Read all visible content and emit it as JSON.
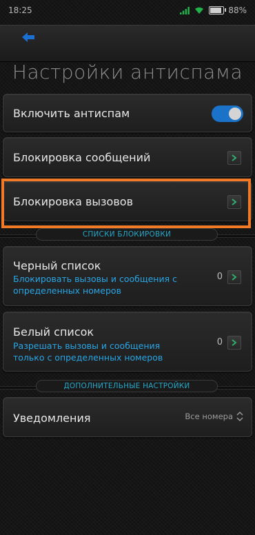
{
  "status_bar": {
    "time": "18:25",
    "battery": "88%"
  },
  "screen": {
    "title": "Настройки антиспама"
  },
  "antispam": {
    "label": "Включить антиспам",
    "enabled": true,
    "accent": "#1a73c9"
  },
  "items": {
    "block_messages": "Блокировка сообщений",
    "block_calls": "Блокировка вызовов"
  },
  "sections": {
    "block_lists": "СПИСКИ БЛОКИРОВКИ",
    "advanced": "ДОПОЛНИТЕЛЬНЫЕ НАСТРОЙКИ"
  },
  "blacklist": {
    "title": "Черный список",
    "subtitle": "Блокировать вызовы и сообщения с определенных номеров",
    "count": "0"
  },
  "whitelist": {
    "title": "Белый список",
    "subtitle": "Разрешать вызовы и сообщения только с определенных номеров",
    "count": "0"
  },
  "notifications": {
    "title": "Уведомления",
    "value": "Все номера"
  },
  "colors": {
    "highlight": "#f07a25",
    "link": "#29a6e6",
    "section_text": "#26a8c9"
  }
}
